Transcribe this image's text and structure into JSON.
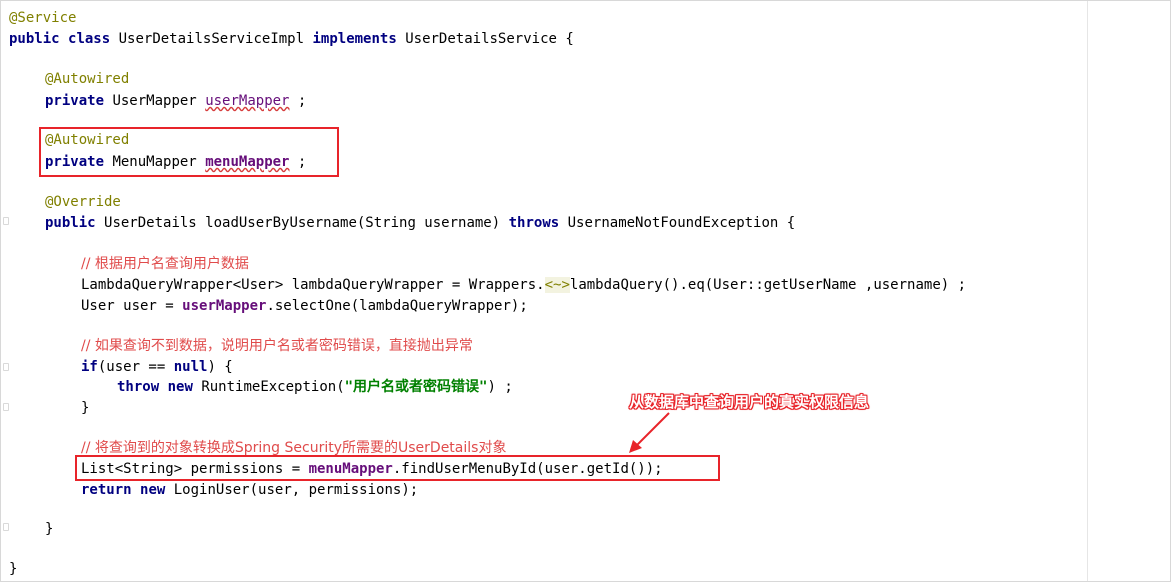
{
  "code": {
    "l1_annotation": "@Service",
    "l2_kw_public": "public",
    "l2_kw_class": "class",
    "l2_classname": "UserDetailsServiceImpl",
    "l2_kw_implements": "implements",
    "l2_iface": "UserDetailsService {",
    "l4_annotation": "@Autowired",
    "l5_kw_private": "private",
    "l5_type": "UserMapper",
    "l5_field": "userMapper",
    "l5_end": " ;",
    "l7_annotation": "@Autowired",
    "l8_kw_private": "private",
    "l8_type": "MenuMapper",
    "l8_field": "menuMapper",
    "l8_end": " ;",
    "l10_annotation": "@Override",
    "l11_kw_public": "public",
    "l11_sig": "UserDetails loadUserByUsername(String username)",
    "l11_kw_throws": "throws",
    "l11_exc": "UsernameNotFoundException {",
    "l13_comment": "// 根据用户名查询用户数据",
    "l14_a": "LambdaQueryWrapper<User> lambdaQueryWrapper = Wrappers.",
    "l14_gen": "<~>",
    "l14_b": "lambdaQuery().eq(User::getUserName ,username) ;",
    "l15_a": "User user = ",
    "l15_field": "userMapper",
    "l15_b": ".selectOne(lambdaQueryWrapper);",
    "l17_comment": "// 如果查询不到数据，说明用户名或者密码错误，直接抛出异常",
    "l18_kw_if": "if",
    "l18_a": "(user == ",
    "l18_kw_null": "null",
    "l18_b": ") {",
    "l19_kw_throw": "throw",
    "l19_kw_new": "new",
    "l19_a": "RuntimeException(",
    "l19_str": "\"用户名或者密码错误\"",
    "l19_b": ") ;",
    "l20_brace": "}",
    "l22_comment": "// 将查询到的对象转换成Spring Security所需要的UserDetails对象",
    "l23_a": "List<String> permissions = ",
    "l23_field": "menuMapper",
    "l23_b": ".findUserMenuById(user.getId());",
    "l24_kw_return": "return",
    "l24_kw_new": "new",
    "l24_a": "LoginUser(user, permissions);",
    "l26_brace": "}",
    "l28_brace": "}"
  },
  "callout_text": "从数据库中查询用户的真实权限信息",
  "colors": {
    "highlight_box": "#e8242a",
    "comment": "#e04b4b",
    "keyword": "#000080",
    "annotation": "#808000"
  }
}
